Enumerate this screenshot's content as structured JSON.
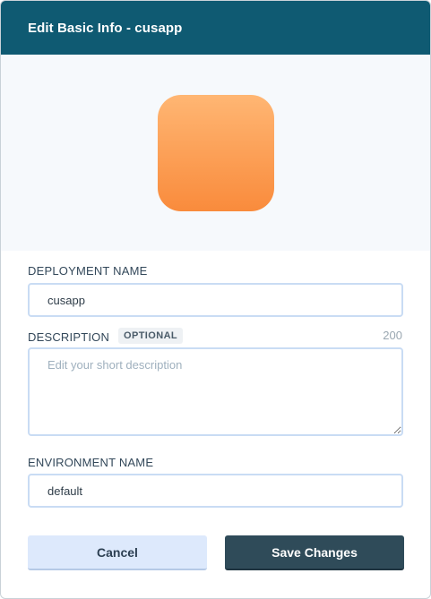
{
  "dialog": {
    "title": "Edit Basic Info - cusapp"
  },
  "app_icon": {
    "name": "app-icon",
    "gradient_top": "#ffb673",
    "gradient_bottom": "#f98b3c"
  },
  "fields": {
    "deployment_name": {
      "label": "DEPLOYMENT NAME",
      "value": "cusapp"
    },
    "description": {
      "label": "DESCRIPTION",
      "badge": "OPTIONAL",
      "char_limit": "200",
      "value": "",
      "placeholder": "Edit your short description"
    },
    "environment_name": {
      "label": "ENVIRONMENT NAME",
      "value": "default"
    }
  },
  "buttons": {
    "cancel_label": "Cancel",
    "save_label": "Save Changes"
  },
  "colors": {
    "header_bg": "#0f5a72",
    "save_bg": "#2f4b59",
    "cancel_bg": "#dde9fc",
    "input_border": "#c9dcf4"
  }
}
